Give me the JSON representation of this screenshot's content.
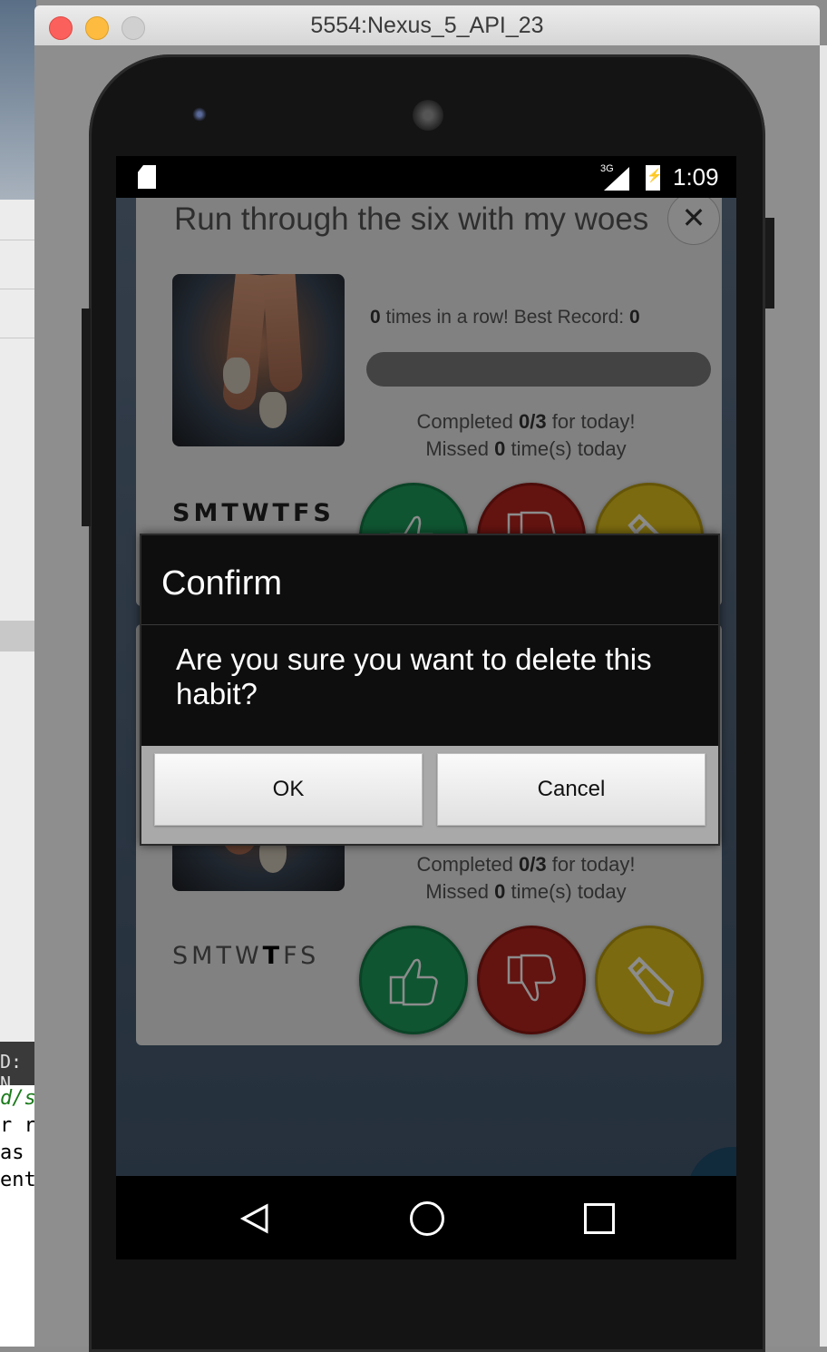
{
  "window": {
    "title": "5554:Nexus_5_API_23"
  },
  "background": {
    "ide_panel_label": "D: N",
    "code_lines": [
      "d/s",
      "r r",
      "as",
      "ent"
    ]
  },
  "statusbar": {
    "network_label": "3G",
    "time": "1:09"
  },
  "habits": [
    {
      "title": "Run through the six with my woes",
      "streak_prefix": " times in a row! Best Record: ",
      "streak_count": "0",
      "best_record": "0",
      "progress": 0,
      "completed_label": "Completed ",
      "completed_value": "0/3",
      "completed_suffix": " for today!",
      "missed_label": "Missed ",
      "missed_value": "0",
      "missed_suffix": " time(s) today",
      "days": [
        "S",
        "M",
        "T",
        "W",
        "T",
        "F",
        "S"
      ],
      "days_bold_all": true
    },
    {
      "completed_label": "Completed ",
      "completed_value": "0/3",
      "completed_suffix": " for today!",
      "missed_label": "Missed ",
      "missed_value": "0",
      "missed_suffix": " time(s) today",
      "days": [
        "S",
        "M",
        "T",
        "W",
        "T",
        "F",
        "S"
      ],
      "highlighted_day_index": 4
    }
  ],
  "dialog": {
    "title": "Confirm",
    "message": "Are you sure you want to delete this habit?",
    "ok_label": "OK",
    "cancel_label": "Cancel"
  },
  "icons": {
    "close": "close-icon",
    "thumbs_up": "thumbs-up-icon",
    "thumbs_down": "thumbs-down-icon",
    "edit": "pencil-icon",
    "nav_back": "back-icon",
    "nav_home": "home-icon",
    "nav_recent": "recent-apps-icon"
  },
  "colors": {
    "success": "#1c9c5c",
    "fail": "#b5241e",
    "edit": "#e0c21c"
  }
}
